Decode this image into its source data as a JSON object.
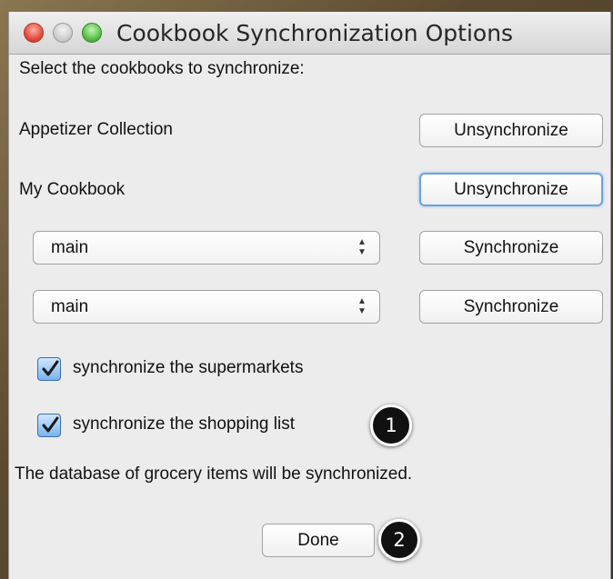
{
  "window": {
    "title": "Cookbook Synchronization Options"
  },
  "instruction": "Select the cookbooks to synchronize:",
  "cookbooks": [
    {
      "name": "Appetizer Collection",
      "button": "Unsynchronize"
    },
    {
      "name": "My Cookbook",
      "button": "Unsynchronize"
    },
    {
      "select_value": "main",
      "button": "Synchronize"
    },
    {
      "select_value": "main",
      "button": "Synchronize"
    }
  ],
  "options": {
    "supermarkets": {
      "label": "synchronize the supermarkets",
      "checked": true
    },
    "shopping_list": {
      "label": "synchronize the shopping list",
      "checked": true
    }
  },
  "status_text": "The database of grocery items will be synchronized.",
  "done_label": "Done",
  "badges": [
    "1",
    "2"
  ],
  "colors": {
    "checkbox": "#7ab3ee",
    "focus_ring": "#6fa1e0",
    "badge": "#111111"
  }
}
